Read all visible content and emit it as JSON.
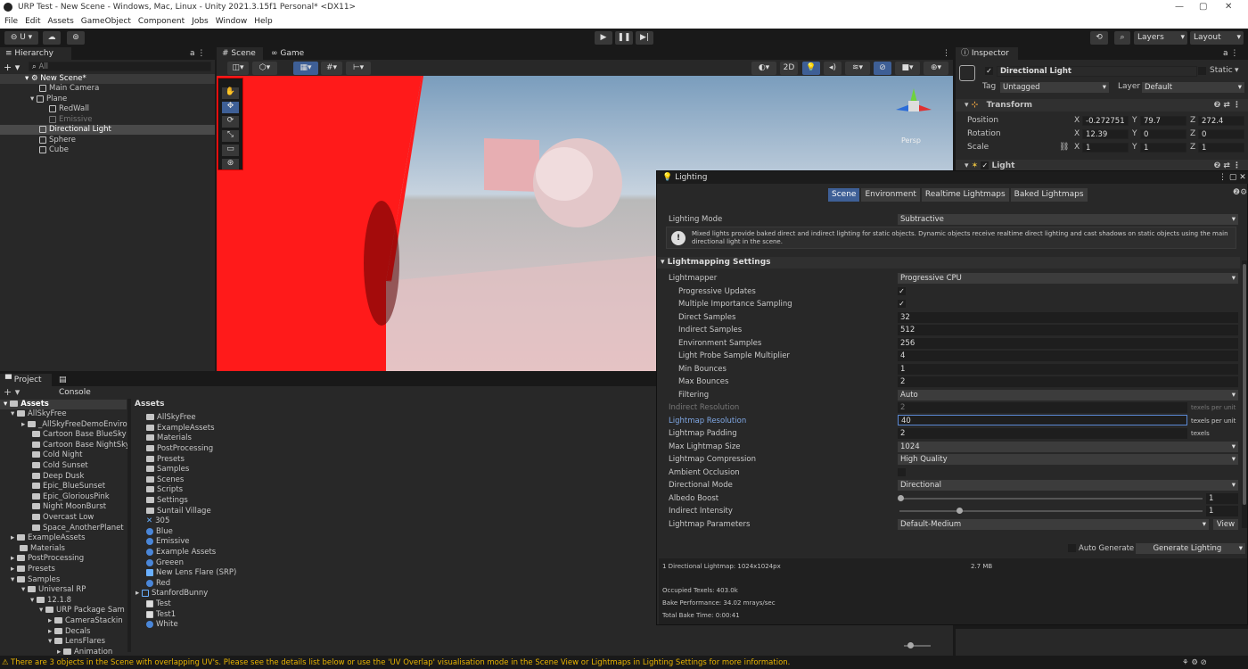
{
  "window": {
    "title": "URP Test - New Scene - Windows, Mac, Linux - Unity 2021.3.15f1 Personal* <DX11>"
  },
  "menu": [
    "File",
    "Edit",
    "Assets",
    "GameObject",
    "Component",
    "Jobs",
    "Window",
    "Help"
  ],
  "toolbar": {
    "layers": "Layers",
    "layout": "Layout"
  },
  "hierarchy": {
    "tab": "Hierarchy",
    "search": "All",
    "items": [
      "New Scene*",
      "Main Camera",
      "Plane",
      "RedWall",
      "Emissive",
      "Directional Light",
      "Sphere",
      "Cube"
    ]
  },
  "scene": {
    "tab_scene": "Scene",
    "tab_game": "Game",
    "btn_2d": "2D",
    "persp": "Persp"
  },
  "inspector": {
    "tab": "Inspector",
    "name": "Directional Light",
    "static": "Static",
    "tag_label": "Tag",
    "tag": "Untagged",
    "layer_label": "Layer",
    "layer": "Default",
    "transform": "Transform",
    "position": "Position",
    "rotation": "Rotation",
    "scale": "Scale",
    "pos": [
      "-0.272751",
      "79.7",
      "272.4"
    ],
    "rot": [
      "12.39",
      "0",
      "0"
    ],
    "scl": [
      "1",
      "1",
      "1"
    ],
    "light": "Light"
  },
  "project": {
    "tab_project": "Project",
    "tab_console": "Console",
    "assets_header": "Assets",
    "tree": [
      "Assets",
      "AllSkyFree",
      "_AllSkyFreeDemoEnviro",
      "Cartoon Base BlueSky",
      "Cartoon Base NightSky",
      "Cold Night",
      "Cold Sunset",
      "Deep Dusk",
      "Epic_BlueSunset",
      "Epic_GloriousPink",
      "Night MoonBurst",
      "Overcast Low",
      "Space_AnotherPlanet",
      "ExampleAssets",
      "Materials",
      "PostProcessing",
      "Presets",
      "Samples",
      "Universal RP",
      "12.1.8",
      "URP Package Sam",
      "CameraStackin",
      "Decals",
      "LensFlares",
      "Animation"
    ],
    "list": [
      "AllSkyFree",
      "ExampleAssets",
      "Materials",
      "PostProcessing",
      "Presets",
      "Samples",
      "Scenes",
      "Scripts",
      "Settings",
      "Suntail Village",
      "305",
      "Blue",
      "Emissive",
      "Example Assets",
      "Greeen",
      "New Lens Flare (SRP)",
      "Red",
      "StanfordBunny",
      "Test",
      "Test1",
      "White"
    ]
  },
  "lighting": {
    "title": "Lighting",
    "tabs": [
      "Scene",
      "Environment",
      "Realtime Lightmaps",
      "Baked Lightmaps"
    ],
    "mode_label": "Lighting Mode",
    "mode": "Subtractive",
    "info": "Mixed lights provide baked direct and indirect lighting for static objects. Dynamic objects receive realtime direct lighting and cast shadows on static objects using the main directional light in the scene.",
    "section": "Lightmapping Settings",
    "rows": [
      {
        "label": "Lightmapper",
        "value": "Progressive CPU"
      },
      {
        "label": "Progressive Updates",
        "value": "✓"
      },
      {
        "label": "Multiple Importance Sampling",
        "value": "✓"
      },
      {
        "label": "Direct Samples",
        "value": "32"
      },
      {
        "label": "Indirect Samples",
        "value": "512"
      },
      {
        "label": "Environment Samples",
        "value": "256"
      },
      {
        "label": "Light Probe Sample Multiplier",
        "value": "4"
      },
      {
        "label": "Min Bounces",
        "value": "1"
      },
      {
        "label": "Max Bounces",
        "value": "2"
      },
      {
        "label": "Filtering",
        "value": "Auto"
      },
      {
        "label": "Indirect Resolution",
        "value": "2"
      },
      {
        "label": "Lightmap Resolution",
        "value": "40"
      },
      {
        "label": "Lightmap Padding",
        "value": "2"
      },
      {
        "label": "Max Lightmap Size",
        "value": "1024"
      },
      {
        "label": "Lightmap Compression",
        "value": "High Quality"
      },
      {
        "label": "Ambient Occlusion",
        "value": ""
      },
      {
        "label": "Directional Mode",
        "value": "Directional"
      },
      {
        "label": "Albedo Boost",
        "value": "1"
      },
      {
        "label": "Indirect Intensity",
        "value": "1"
      },
      {
        "label": "Lightmap Parameters",
        "value": "Default-Medium"
      }
    ],
    "texels_per_unit": "texels per unit",
    "texels": "texels",
    "view": "View",
    "auto_generate": "Auto Generate",
    "generate": "Generate Lighting",
    "stats": {
      "lightmaps": "1 Directional Lightmap: 1024x1024px",
      "size": "2.7 MB",
      "occupied": "Occupied Texels: 403.0k",
      "perf": "Bake Performance: 34.02 mrays/sec",
      "time": "Total Bake Time: 0:00:41"
    }
  },
  "status": "There are 3 objects in the Scene with overlapping UV's. Please see the details list below or use the 'UV Overlap' visualisation mode in the Scene View or Lightmaps in Lighting Settings for more information.",
  "colors": {
    "accent": "#3e5f96",
    "warning": "#e8b400",
    "red_wall": "#ff1a1a"
  }
}
